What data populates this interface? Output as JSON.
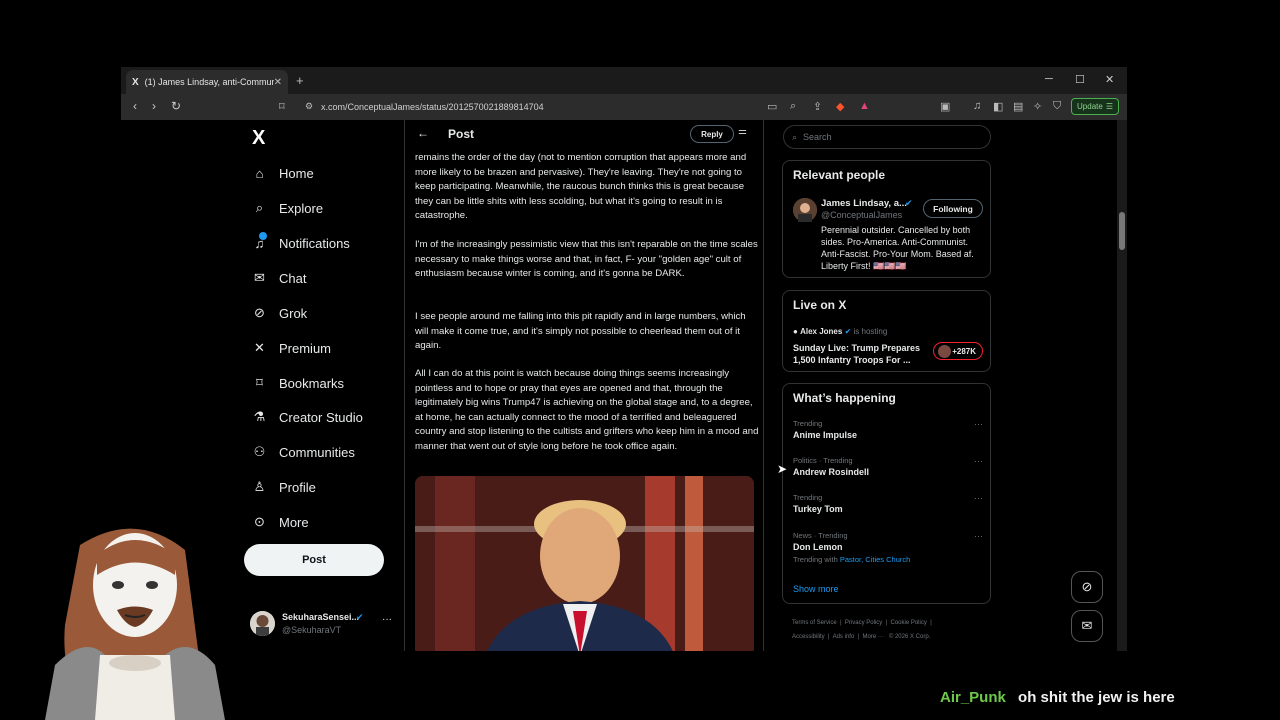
{
  "browser": {
    "tab_title": "(1) James Lindsay, anti-Commun",
    "tab_favicon": "X",
    "url": "x.com/ConceptualJames/status/2012570021889814704",
    "update_label": "Update"
  },
  "nav": {
    "logo": "X",
    "items": [
      {
        "label": "Home",
        "icon": "home-icon"
      },
      {
        "label": "Explore",
        "icon": "search-icon"
      },
      {
        "label": "Notifications",
        "icon": "bell-icon"
      },
      {
        "label": "Chat",
        "icon": "mail-icon"
      },
      {
        "label": "Grok",
        "icon": "grok-icon"
      },
      {
        "label": "Premium",
        "icon": "x-icon"
      },
      {
        "label": "Bookmarks",
        "icon": "bookmark-icon"
      },
      {
        "label": "Creator Studio",
        "icon": "flask-icon"
      },
      {
        "label": "Communities",
        "icon": "people-icon"
      },
      {
        "label": "Profile",
        "icon": "person-icon"
      },
      {
        "label": "More",
        "icon": "more-icon"
      }
    ],
    "post_label": "Post",
    "account_name": "SekuharaSensei...",
    "account_handle": "@SekuharaVT"
  },
  "main": {
    "header_title": "Post",
    "reply_label": "Reply",
    "paragraphs": [
      "remains the order of the day (not to mention corruption that appears more and more likely to be brazen and pervasive). They're leaving. They're not going to keep participating. Meanwhile, the raucous bunch thinks this is great because they can be little shits with less scolding, but what it's going to result in is catastrophe.",
      "I'm of the increasingly pessimistic view that this isn't reparable on the time scales necessary to make things worse and that, in fact, F- your \"golden age\" cult of enthusiasm because winter is coming, and it's gonna be DARK.",
      "I see people around me falling into this pit rapidly and in large numbers, which will make it come true, and it's simply not possible to cheerlead them out of it again.",
      "All I can do at this point is watch because doing things seems increasingly pointless and to hope or pray that eyes are opened and that, through the legitimately big wins Trump47 is achieving on the global stage and, to a degree, at home, he can actually connect to the mood of a terrified and beleaguered country and stop listening to the cultists and grifters who keep him in a mood and manner that went out of style long before he took office again."
    ]
  },
  "sidebar": {
    "search_placeholder": "Search",
    "relevant": {
      "title": "Relevant people",
      "name": "James Lindsay, a...",
      "handle": "@ConceptualJames",
      "follow_label": "Following",
      "bio": "Perennial outsider. Cancelled by both sides. Pro-America. Anti-Communist. Anti-Fascist. Pro-Your Mom. Based af. Liberty First! 🇺🇸🇺🇸🇺🇸"
    },
    "live": {
      "title": "Live on X",
      "host": "Alex Jones",
      "host_suffix": "is hosting",
      "stream_title": "Sunday Live: Trump Prepares 1,500 Infantry Troops For ...",
      "viewers": "+287K"
    },
    "happening": {
      "title": "What’s happening",
      "trends": [
        {
          "category": "Trending",
          "name": "Anime Impulse",
          "with": ""
        },
        {
          "category": "Politics · Trending",
          "name": "Andrew Rosindell",
          "with": ""
        },
        {
          "category": "Trending",
          "name": "Turkey Tom",
          "with": ""
        },
        {
          "category": "News · Trending",
          "name": "Don Lemon",
          "with_prefix": "Trending with",
          "with": "Pastor, Cities Church"
        }
      ],
      "show_more": "Show more"
    },
    "footer": [
      "Terms of Service",
      "Privacy Policy",
      "Cookie Policy",
      "Accessibility",
      "Ads info",
      "More ···",
      "© 2026 X Corp."
    ]
  },
  "overlay": {
    "chat_user": "Air_Punk",
    "chat_message": "oh shit the jew is here"
  },
  "colors": {
    "accent": "#1d9bf0",
    "live_red": "#f4212e",
    "chat_user": "#6ec84a"
  }
}
